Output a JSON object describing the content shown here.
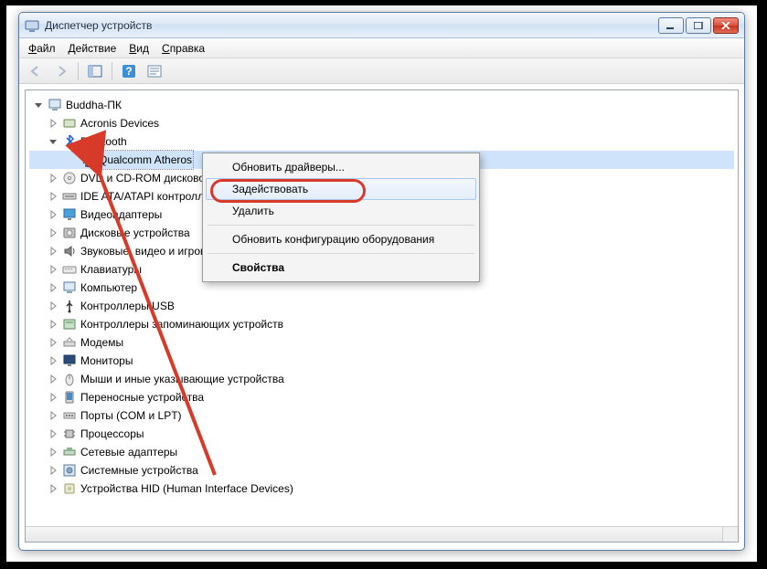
{
  "window": {
    "title": "Диспетчер устройств"
  },
  "menu": {
    "file": "Файл",
    "action": "Действие",
    "view": "Вид",
    "help": "Справка"
  },
  "tree": {
    "root": "Buddha-ПК",
    "items": [
      {
        "label": "Acronis Devices",
        "icon": "generic"
      },
      {
        "label": "Bluetooth",
        "icon": "bluetooth",
        "expanded": true,
        "children": [
          {
            "label": "Qualcomm Atheros",
            "icon": "bluetooth-disabled",
            "selected": true
          }
        ]
      },
      {
        "label": "DVD и CD-ROM дисководы",
        "icon": "disc"
      },
      {
        "label": "IDE ATA/ATAPI контроллеры",
        "icon": "ide"
      },
      {
        "label": "Видеоадаптеры",
        "icon": "display"
      },
      {
        "label": "Дисковые устройства",
        "icon": "hdd"
      },
      {
        "label": "Звуковые, видео и игровые устройства",
        "icon": "audio"
      },
      {
        "label": "Клавиатуры",
        "icon": "keyboard"
      },
      {
        "label": "Компьютер",
        "icon": "computer"
      },
      {
        "label": "Контроллеры USB",
        "icon": "usb"
      },
      {
        "label": "Контроллеры запоминающих устройств",
        "icon": "storage"
      },
      {
        "label": "Модемы",
        "icon": "modem"
      },
      {
        "label": "Мониторы",
        "icon": "monitor"
      },
      {
        "label": "Мыши и иные указывающие устройства",
        "icon": "mouse"
      },
      {
        "label": "Переносные устройства",
        "icon": "portable"
      },
      {
        "label": "Порты (COM и LPT)",
        "icon": "port"
      },
      {
        "label": "Процессоры",
        "icon": "cpu"
      },
      {
        "label": "Сетевые адаптеры",
        "icon": "network"
      },
      {
        "label": "Системные устройства",
        "icon": "system"
      },
      {
        "label": "Устройства HID (Human Interface Devices)",
        "icon": "hid"
      }
    ]
  },
  "context_menu": {
    "update": "Обновить драйверы...",
    "enable": "Задействовать",
    "delete": "Удалить",
    "refresh": "Обновить конфигурацию оборудования",
    "properties": "Свойства"
  }
}
